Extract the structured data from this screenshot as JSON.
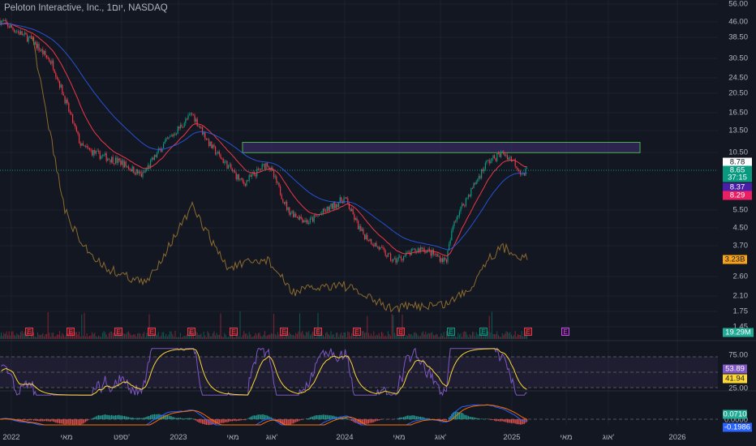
{
  "header": {
    "title": "Peloton Interactive, Inc., 1יום, NASDAQ"
  },
  "price_axis": {
    "ticks": [
      "56.00",
      "46.00",
      "38.50",
      "30.50",
      "24.50",
      "20.50",
      "16.50",
      "13.50",
      "10.50",
      "5.50",
      "4.50",
      "3.70",
      "2.60",
      "2.10",
      "1.75",
      "1.45"
    ]
  },
  "price_tags": {
    "last": "8.78",
    "close": "8.65",
    "countdown": "37:15",
    "ma1": "8.37",
    "ma2": "8.29",
    "secondary": "3.23B",
    "volume": "19.29M"
  },
  "rsi": {
    "ticks": [
      "75.00",
      "25.00"
    ],
    "value": "53.89",
    "signal": "41.94"
  },
  "macd": {
    "value": "0.0710",
    "zero": "0.0000",
    "signal": "-0.1986"
  },
  "time_axis": [
    "2022",
    "מאי",
    "ספט'",
    "2023",
    "מאי",
    "אוג'",
    "2024",
    "מאי",
    "אוג'",
    "2025",
    "מאי",
    "אוג'",
    "2026"
  ],
  "earnings_markers": [
    {
      "label": "E",
      "color": "#f23645"
    },
    {
      "label": "E",
      "color": "#f23645"
    },
    {
      "label": "E",
      "color": "#f23645"
    },
    {
      "label": "E",
      "color": "#f23645"
    },
    {
      "label": "E",
      "color": "#f23645"
    },
    {
      "label": "E",
      "color": "#f23645"
    },
    {
      "label": "E",
      "color": "#f23645"
    },
    {
      "label": "E",
      "color": "#f23645"
    },
    {
      "label": "E",
      "color": "#f23645"
    },
    {
      "label": "E",
      "color": "#f23645"
    },
    {
      "label": "E",
      "color": "#089981"
    },
    {
      "label": "E",
      "color": "#089981"
    },
    {
      "label": "E",
      "color": "#f23645"
    },
    {
      "label": "E",
      "color": "#e040fb"
    }
  ],
  "colors": {
    "up": "#089981",
    "down": "#f23645",
    "zone_border": "#4caf50",
    "zone_fill": "#3a2d6e",
    "ma_red": "#f23645",
    "ma_blue": "#2962ff",
    "secondary_line": "#8d6a2e",
    "rsi": "#7e57c2",
    "rsi_ma": "#fdd835"
  },
  "chart_data": {
    "type": "candlestick",
    "scale": "log",
    "approx_path": {
      "dates": [
        "2021-12",
        "2022-02",
        "2022-04",
        "2022-06",
        "2022-07",
        "2022-09",
        "2022-10",
        "2022-12",
        "2023-02",
        "2023-03",
        "2023-06",
        "2023-07",
        "2023-08",
        "2023-10",
        "2023-12",
        "2024-01",
        "2024-03",
        "2024-04",
        "2024-06",
        "2024-07",
        "2024-08",
        "2024-10",
        "2024-11",
        "2025-01",
        "2025-02"
      ],
      "price": [
        46.6,
        37,
        28.5,
        11.3,
        10.3,
        9.4,
        8.1,
        11.3,
        16.3,
        11.3,
        7.4,
        9.4,
        5.5,
        4.8,
        6.3,
        4.3,
        3.1,
        3.6,
        3.1,
        4.9,
        9.4,
        10.5,
        9.6,
        8.1,
        8.78
      ]
    },
    "resistance_zone": [
      10.5,
      11.8
    ]
  }
}
